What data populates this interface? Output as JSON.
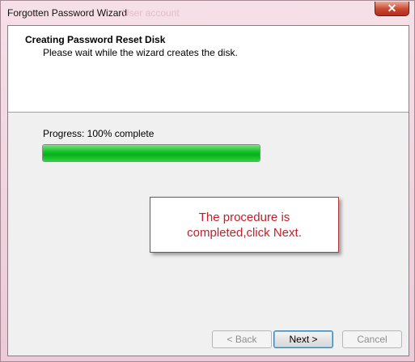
{
  "window": {
    "title": "Forgotten Password Wizard",
    "title_ghost": "User account",
    "close_label": "✕"
  },
  "header": {
    "title": "Creating Password Reset Disk",
    "subtitle": "Please wait while the wizard creates the disk."
  },
  "progress": {
    "label": "Progress: 100% complete",
    "value": 100
  },
  "annotation": {
    "line1": "The procedure is",
    "line2": "completed,click Next."
  },
  "buttons": {
    "back": "< Back",
    "next": "Next >",
    "cancel": "Cancel"
  },
  "colors": {
    "progress_fill": "#06b019",
    "annotation_text": "#c21f2a",
    "annotation_border": "#b33a3a"
  }
}
